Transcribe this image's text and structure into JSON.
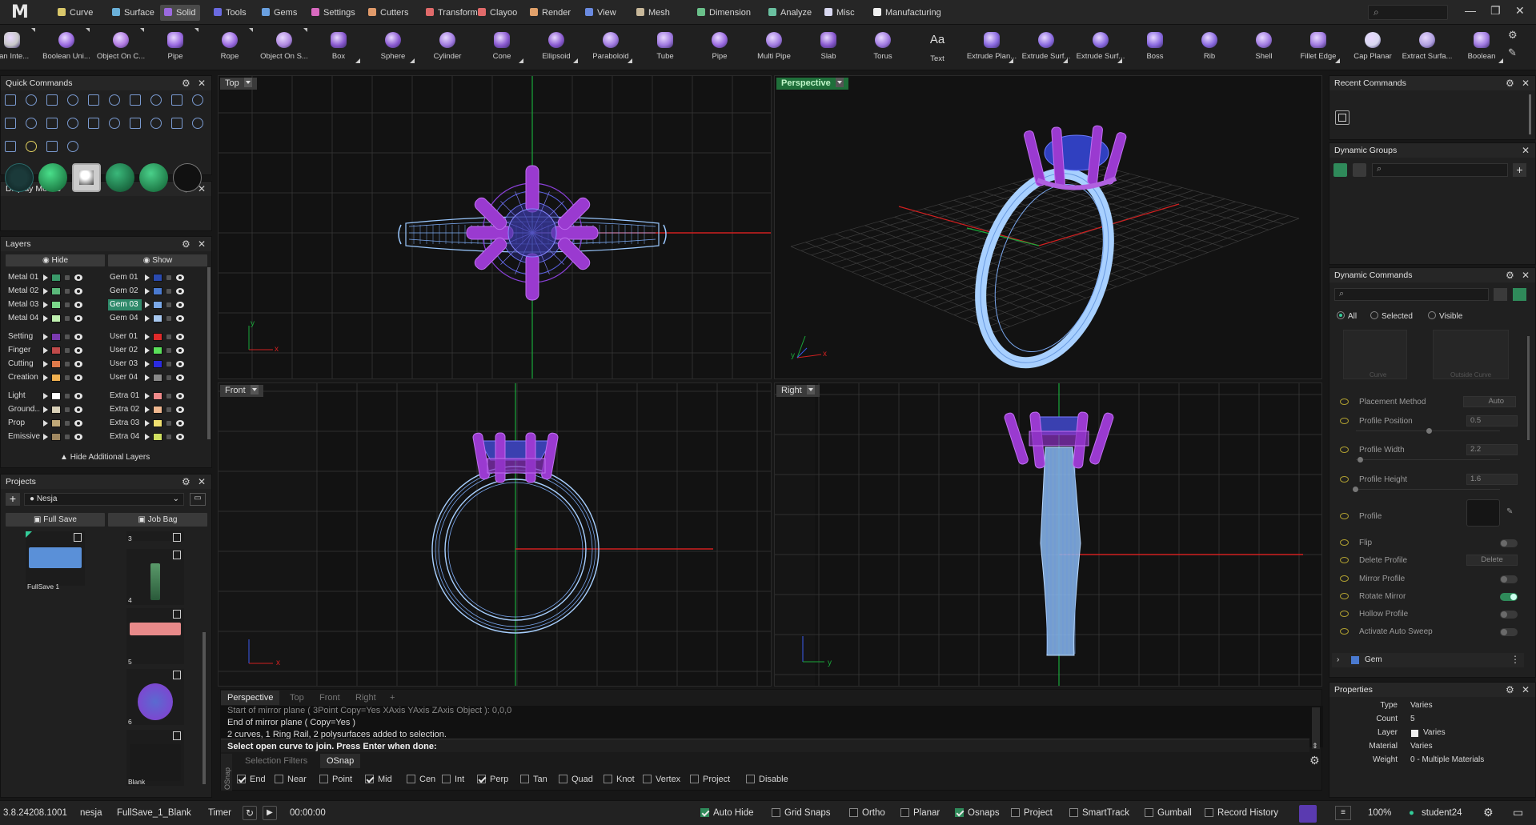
{
  "app": {
    "logo": "M"
  },
  "menu": [
    {
      "label": "Curve",
      "color": "#d9c76a"
    },
    {
      "label": "Surface",
      "color": "#6ab0d9"
    },
    {
      "label": "Solid",
      "color": "#9b6ae0",
      "active": true
    },
    {
      "label": "Tools",
      "color": "#6a6ae0"
    },
    {
      "label": "Gems",
      "color": "#6aa0e0"
    },
    {
      "label": "Settings",
      "color": "#d96ac0"
    },
    {
      "label": "Cutters",
      "color": "#e09a6a"
    },
    {
      "label": "Transform",
      "color": "#e06a6a"
    },
    {
      "label": "Clayoo",
      "color": "#e06a6a"
    },
    {
      "label": "Render",
      "color": "#e0a06a"
    },
    {
      "label": "View",
      "color": "#6a8ae0"
    },
    {
      "label": "Mesh",
      "color": "#c8b89a"
    },
    {
      "label": "Dimension",
      "color": "#6ac08a"
    },
    {
      "label": "Analyze",
      "color": "#6ac0a0"
    },
    {
      "label": "Misc",
      "color": "#d8d8f0"
    },
    {
      "label": "Manufacturing",
      "color": "#f0f0f0"
    }
  ],
  "window": {
    "search_placeholder": "⌕",
    "minimize": "—",
    "restore": "❐",
    "close": "✕"
  },
  "toolbar": [
    {
      "label": "ean Inte...",
      "icon": "boolean-intersection-icon",
      "tri": false
    },
    {
      "label": "Boolean Uni...",
      "icon": "boolean-union-icon"
    },
    {
      "label": "Object On C...",
      "icon": "object-on-curve-icon"
    },
    {
      "label": "Pipe",
      "icon": "pipe-icon"
    },
    {
      "label": "Rope",
      "icon": "rope-icon"
    },
    {
      "label": "Object On S...",
      "icon": "object-on-surface-icon"
    },
    {
      "label": "Box",
      "icon": "box-icon",
      "tri": true
    },
    {
      "label": "Sphere",
      "icon": "sphere-icon",
      "tri": true
    },
    {
      "label": "Cylinder",
      "icon": "cylinder-icon"
    },
    {
      "label": "Cone",
      "icon": "cone-icon",
      "tri": true
    },
    {
      "label": "Ellipsoid",
      "icon": "ellipsoid-icon",
      "tri": true
    },
    {
      "label": "Paraboloid",
      "icon": "paraboloid-icon",
      "tri": true
    },
    {
      "label": "Tube",
      "icon": "tube-icon"
    },
    {
      "label": "Pipe",
      "icon": "pipe2-icon"
    },
    {
      "label": "Multi Pipe",
      "icon": "multi-pipe-icon"
    },
    {
      "label": "Slab",
      "icon": "slab-icon"
    },
    {
      "label": "Torus",
      "icon": "torus-icon"
    },
    {
      "label": "Text",
      "icon": "text-icon"
    },
    {
      "label": "Extrude Plan...",
      "icon": "extrude-planar-icon",
      "tri": true
    },
    {
      "label": "Extrude Surf...",
      "icon": "extrude-surface-icon",
      "tri": true
    },
    {
      "label": "Extrude Surf...",
      "icon": "extrude-surface2-icon",
      "tri": true
    },
    {
      "label": "Boss",
      "icon": "boss-icon"
    },
    {
      "label": "Rib",
      "icon": "rib-icon"
    },
    {
      "label": "Shell",
      "icon": "shell-icon"
    },
    {
      "label": "Fillet Edge",
      "icon": "fillet-edge-icon",
      "tri": true
    },
    {
      "label": "Cap Planar",
      "icon": "cap-planar-icon"
    },
    {
      "label": "Extract Surfa...",
      "icon": "extract-surface-icon"
    },
    {
      "label": "Boolean",
      "icon": "boolean-icon",
      "tri": true
    }
  ],
  "panels": {
    "quick_commands": {
      "title": "Quick Commands"
    },
    "display_modes": {
      "title": "Display Modes"
    },
    "layers": {
      "title": "Layers",
      "hide": "Hide",
      "show": "Show",
      "more": "Hide Additional Layers",
      "left": [
        {
          "name": "Metal 01",
          "color": "#3a9a6a"
        },
        {
          "name": "Metal 02",
          "color": "#5ab87a"
        },
        {
          "name": "Metal 03",
          "color": "#7ad88a"
        },
        {
          "name": "Metal 04",
          "color": "#bff0b0"
        },
        {
          "name": "Setting",
          "color": "#7a3ab0"
        },
        {
          "name": "Finger",
          "color": "#c04a4a"
        },
        {
          "name": "Cutting",
          "color": "#e07a4a"
        },
        {
          "name": "Creation",
          "color": "#f0b050"
        },
        {
          "name": "Light",
          "color": "#ffffff"
        },
        {
          "name": "Ground...",
          "color": "#d8d0b8"
        },
        {
          "name": "Prop",
          "color": "#c0a878"
        },
        {
          "name": "Emissive",
          "color": "#a08860"
        }
      ],
      "right": [
        {
          "name": "Gem 01",
          "color": "#2a4ab0"
        },
        {
          "name": "Gem 02",
          "color": "#4a7ad0"
        },
        {
          "name": "Gem 03",
          "color": "#7aa8e8",
          "selected": true
        },
        {
          "name": "Gem 04",
          "color": "#a8c8f0"
        },
        {
          "name": "User 01",
          "color": "#e02a2a"
        },
        {
          "name": "User 02",
          "color": "#5ae05a"
        },
        {
          "name": "User 03",
          "color": "#2a2ae0"
        },
        {
          "name": "User 04",
          "color": "#8a8a8a"
        },
        {
          "name": "Extra 01",
          "color": "#f08a8a"
        },
        {
          "name": "Extra 02",
          "color": "#f0b890"
        },
        {
          "name": "Extra 03",
          "color": "#f0e070"
        },
        {
          "name": "Extra 04",
          "color": "#d0e060"
        }
      ]
    },
    "projects": {
      "title": "Projects",
      "project": "Nesja",
      "full_save": "Full Save",
      "job_bag": "Job Bag",
      "thumbs": [
        {
          "label": "FullSave 1"
        },
        {
          "label": "3"
        },
        {
          "label": "4"
        },
        {
          "label": "5"
        },
        {
          "label": "6"
        },
        {
          "label": "Blank"
        }
      ]
    },
    "recent": {
      "title": "Recent Commands"
    },
    "dyn_groups": {
      "title": "Dynamic Groups"
    },
    "dyn_cmds": {
      "title": "Dynamic Commands",
      "filter_all": "All",
      "filter_selected": "Selected",
      "filter_visible": "Visible",
      "slot1": "Curve",
      "slot2": "Outside Curve",
      "rows": [
        {
          "label": "Placement Method",
          "value": "Auto"
        },
        {
          "label": "Profile Position",
          "value": "0.5"
        },
        {
          "label": "Profile Width",
          "value": "2.2"
        },
        {
          "label": "Profile Height",
          "value": "1.6"
        },
        {
          "label": "Profile"
        },
        {
          "label": "Flip"
        },
        {
          "label": "Delete Profile",
          "value": "Delete"
        },
        {
          "label": "Mirror Profile"
        },
        {
          "label": "Rotate Mirror"
        },
        {
          "label": "Hollow Profile"
        },
        {
          "label": "Activate Auto Sweep"
        }
      ],
      "group": "Gem"
    },
    "properties": {
      "title": "Properties",
      "rows": [
        {
          "k": "Type",
          "v": "Varies"
        },
        {
          "k": "Count",
          "v": "5"
        },
        {
          "k": "Layer",
          "v": "Varies"
        },
        {
          "k": "Material",
          "v": "Varies"
        },
        {
          "k": "Weight",
          "v": "0 - Multiple Materials"
        }
      ]
    }
  },
  "viewports": {
    "top": "Top",
    "perspective": "Perspective",
    "front": "Front",
    "right": "Right",
    "axis": {
      "x": "x",
      "y": "y"
    }
  },
  "view_tabs": [
    "Perspective",
    "Top",
    "Front",
    "Right",
    "+"
  ],
  "command": {
    "history": [
      "Start of mirror plane ( 3Point  Copy=Yes  XAxis  YAxis  ZAxis  Object ): 0,0,0",
      "End of mirror plane ( Copy=Yes )",
      "2 curves, 1 Ring Rail, 2 polysurfaces added to selection."
    ],
    "prompt": "Select open curve to join. Press Enter when done:",
    "tabs": [
      "Selection Filters",
      "OSnap"
    ],
    "side_label": "OSnap",
    "osnaps": [
      {
        "label": "End",
        "on": true
      },
      {
        "label": "Near",
        "on": false
      },
      {
        "label": "Point",
        "on": false
      },
      {
        "label": "Mid",
        "on": true
      },
      {
        "label": "Cen",
        "on": false
      },
      {
        "label": "Int",
        "on": false
      },
      {
        "label": "Perp",
        "on": true
      },
      {
        "label": "Tan",
        "on": false
      },
      {
        "label": "Quad",
        "on": false
      },
      {
        "label": "Knot",
        "on": false
      },
      {
        "label": "Vertex",
        "on": false
      },
      {
        "label": "Project",
        "on": false
      },
      {
        "label": "Disable",
        "on": false
      }
    ]
  },
  "status": {
    "version": "3.8.24208.1001",
    "project": "nesja",
    "file": "FullSave_1_Blank",
    "timer": "Timer",
    "time": "00:00:00",
    "toggles": [
      {
        "label": "Auto Hide",
        "on": true
      },
      {
        "label": "Grid Snaps",
        "on": false
      },
      {
        "label": "Ortho",
        "on": false
      },
      {
        "label": "Planar",
        "on": false
      },
      {
        "label": "Osnaps",
        "on": true
      },
      {
        "label": "Project",
        "on": false
      },
      {
        "label": "SmartTrack",
        "on": false
      },
      {
        "label": "Gumball",
        "on": false
      },
      {
        "label": "Record History",
        "on": false
      }
    ],
    "zoom": "100%",
    "user": "student24"
  },
  "colors": {
    "accent": "#2f8a6a",
    "ring": "#8ab8f0",
    "prong": "#9a3ad0",
    "gem": "#3a4ab0"
  }
}
